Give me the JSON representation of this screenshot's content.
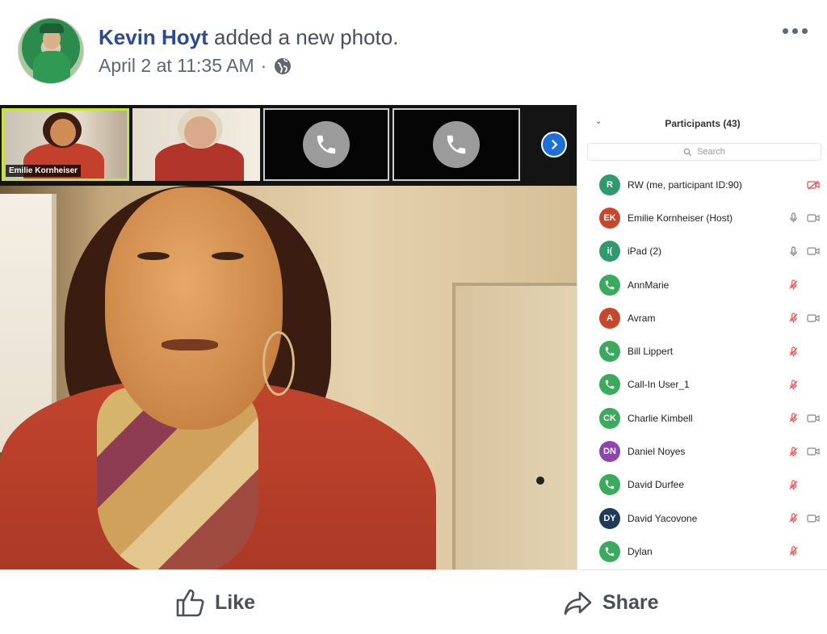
{
  "post": {
    "author": "Kevin Hoyt",
    "action": " added a new photo.",
    "timestamp": "April 2 at 11:35 AM",
    "separator": "·",
    "audience_icon": "globe-icon",
    "more_icon": "more-dots-icon"
  },
  "zoom": {
    "thumbnails": [
      {
        "label": "Emilie Kornheiser",
        "type": "video"
      },
      {
        "label": "",
        "type": "video"
      },
      {
        "label": "",
        "type": "phone"
      },
      {
        "label": "",
        "type": "phone"
      }
    ],
    "next_icon": "chevron-right-icon",
    "participants_panel": {
      "title": "Participants (43)",
      "search_placeholder": "Search",
      "participants": [
        {
          "initials": "R",
          "name": "RW (me, participant ID:90)",
          "color": "#2e9a6e",
          "kind": "avatar",
          "mic": "none",
          "camera": "off-red"
        },
        {
          "initials": "EK",
          "name": "Emilie Kornheiser (Host)",
          "color": "#c8472b",
          "kind": "avatar",
          "mic": "on",
          "camera": "on"
        },
        {
          "initials": "i(",
          "name": "iPad (2)",
          "color": "#2e9a6e",
          "kind": "avatar",
          "mic": "on",
          "camera": "on"
        },
        {
          "initials": "",
          "name": "AnnMarie",
          "color": "#3aaa5c",
          "kind": "phone",
          "mic": "muted",
          "camera": "none"
        },
        {
          "initials": "A",
          "name": "Avram",
          "color": "#c8472b",
          "kind": "avatar",
          "mic": "muted",
          "camera": "on"
        },
        {
          "initials": "",
          "name": "Bill Lippert",
          "color": "#3aaa5c",
          "kind": "phone",
          "mic": "muted",
          "camera": "none"
        },
        {
          "initials": "",
          "name": "Call-In User_1",
          "color": "#3aaa5c",
          "kind": "phone",
          "mic": "muted",
          "camera": "none"
        },
        {
          "initials": "CK",
          "name": "Charlie Kimbell",
          "color": "#3aaa5c",
          "kind": "avatar",
          "mic": "muted",
          "camera": "on"
        },
        {
          "initials": "DN",
          "name": "Daniel Noyes",
          "color": "#8e44ad",
          "kind": "avatar",
          "mic": "muted",
          "camera": "on"
        },
        {
          "initials": "",
          "name": "David Durfee",
          "color": "#3aaa5c",
          "kind": "phone",
          "mic": "muted",
          "camera": "none"
        },
        {
          "initials": "DY",
          "name": "David Yacovone",
          "color": "#1f3b5c",
          "kind": "avatar",
          "mic": "muted",
          "camera": "on"
        },
        {
          "initials": "",
          "name": "Dylan",
          "color": "#3aaa5c",
          "kind": "phone",
          "mic": "muted",
          "camera": "none"
        }
      ]
    }
  },
  "actions": {
    "like_label": "Like",
    "share_label": "Share"
  },
  "colors": {
    "author_link": "#2b4a8f",
    "next_button": "#1e6fd9",
    "muted": "#e04c4c"
  }
}
